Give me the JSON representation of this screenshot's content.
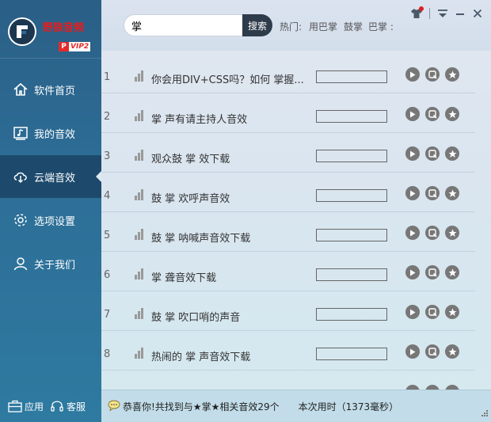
{
  "app": {
    "brand_name": "野狼音频",
    "vip_label": "VIP2",
    "vip_prefix": "P"
  },
  "sidebar": {
    "items": [
      {
        "label": "软件首页",
        "icon": "home-icon"
      },
      {
        "label": "我的音效",
        "icon": "music-note-icon"
      },
      {
        "label": "云端音效",
        "icon": "cloud-download-icon",
        "active": true
      },
      {
        "label": "选项设置",
        "icon": "gear-icon"
      },
      {
        "label": "关于我们",
        "icon": "person-icon"
      }
    ],
    "bottom": {
      "apps_label": "应用",
      "service_label": "客服"
    }
  },
  "search": {
    "value": "掌",
    "button_label": "搜索"
  },
  "hot": {
    "label": "热门:",
    "tags": [
      "用巴掌",
      "鼓掌",
      "巴掌 :"
    ]
  },
  "results": [
    {
      "num": "1",
      "title": "你会用DIV+CSS吗？如何 掌握...",
      "progress": 0
    },
    {
      "num": "2",
      "title": " 掌 声有请主持人音效",
      "progress": 0
    },
    {
      "num": "3",
      "title": "观众鼓 掌 效下载",
      "progress": 0
    },
    {
      "num": "4",
      "title": "鼓 掌 欢呼声音效",
      "progress": 0
    },
    {
      "num": "5",
      "title": "鼓 掌 呐喊声音效下载",
      "progress": 0
    },
    {
      "num": "6",
      "title": " 掌 聋音效下载",
      "progress": 0
    },
    {
      "num": "7",
      "title": "鼓 掌 吹口哨的声音",
      "progress": 0
    },
    {
      "num": "8",
      "title": "热闹的 掌 声音效下载",
      "progress": 0
    }
  ],
  "status": {
    "message": "恭喜你!共找到与★掌★相关音效29个",
    "elapsed": "本次用时（1373毫秒）"
  },
  "colors": {
    "sidebar": "#2d6d96",
    "sidebar_active": "#1d4a6c",
    "brand": "#e61d1d",
    "search_button": "#2e3b4a",
    "statusbar": "#c2dde9"
  }
}
